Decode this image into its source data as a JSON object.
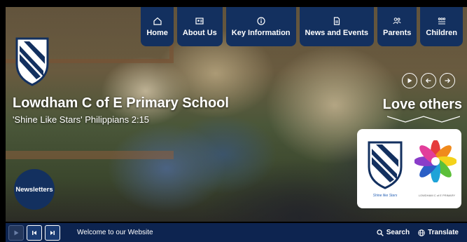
{
  "nav": [
    {
      "label": "Home",
      "icon": "home-icon"
    },
    {
      "label": "About Us",
      "icon": "id-card-icon"
    },
    {
      "label": "Key Information",
      "icon": "info-icon"
    },
    {
      "label": "News and Events",
      "icon": "document-icon"
    },
    {
      "label": "Parents",
      "icon": "people-icon"
    },
    {
      "label": "Children",
      "icon": "children-icon"
    }
  ],
  "hero": {
    "title": "Lowdham C of E Primary School",
    "subtitle": "'Shine Like Stars' Philippians 2:15",
    "tagline": "Love others"
  },
  "card": {
    "caption_left": "Shine like Stars",
    "caption_right": "LOWDHAM C of E PRIMARY"
  },
  "newsletters": "Newsletters",
  "bottombar": {
    "welcome": "Welcome to our Website",
    "search": "Search",
    "translate": "Translate"
  },
  "colors": {
    "navy": "#13305f",
    "bar": "#0d2450",
    "accent": "#2a64b6"
  }
}
